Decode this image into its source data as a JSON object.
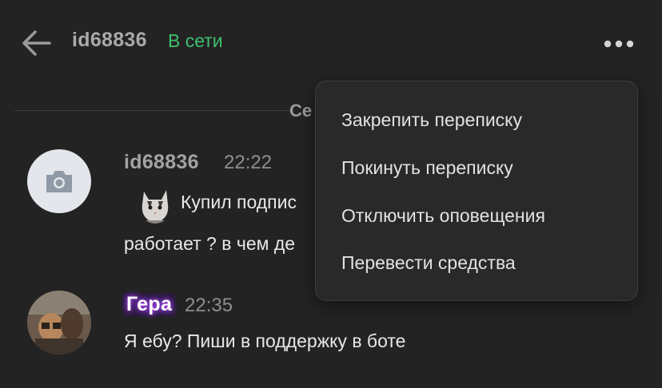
{
  "header": {
    "back_icon": "arrow-left-icon",
    "title": "id68836",
    "status": "В сети",
    "status_color": "#3fbf6f",
    "more_icon": "more-dots-icon"
  },
  "date_divider": "Се",
  "messages": [
    {
      "author": "id68836",
      "time": "22:22",
      "avatar_icon": "camera-icon",
      "sticker_icon": "cat-sticker-icon",
      "text_line1": "Купил подпис",
      "text_line2": "работает ? в чем де"
    },
    {
      "author": "Гера",
      "time": "22:35",
      "avatar_icon": "user-photo",
      "text_line1": "Я ебу? Пиши в поддержку в боте"
    }
  ],
  "menu": {
    "items": [
      "Закрепить переписку",
      "Покинуть переписку",
      "Отключить оповещения",
      "Перевести средства"
    ]
  }
}
